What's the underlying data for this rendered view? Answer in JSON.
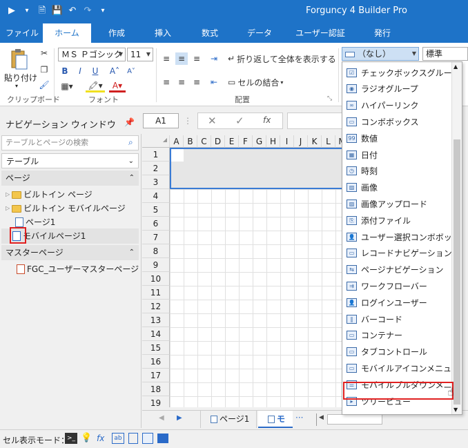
{
  "app": {
    "title": "Forguncy 4 Builder Pro"
  },
  "tabs": [
    "ファイル",
    "ホーム",
    "作成",
    "挿入",
    "数式",
    "データ",
    "ユーザー認証",
    "発行"
  ],
  "ribbon": {
    "paste_label": "貼り付け",
    "clipboard_label": "クリップボード",
    "font_name": "ＭＳ Ｐゴシック",
    "font_size": "11",
    "font_group_label": "フォント",
    "wrap_label": "折り返して全体を表示する",
    "merge_label": "セルの結合",
    "align_group_label": "配置",
    "celltype_selected": "（なし）",
    "style_value": "標準"
  },
  "formula_bar": {
    "cell_ref": "A1",
    "fx": "fx"
  },
  "nav": {
    "title": "ナビゲーション ウィンドウ",
    "search_placeholder": "テーブルとページの検索",
    "table_section": "テーブル",
    "page_section": "ページ",
    "pages": [
      "ビルトイン ページ",
      "ビルトイン モバイルページ",
      "ページ1",
      "モバイルページ1"
    ],
    "master_section": "マスターページ",
    "masters": [
      "FGC_ユーザーマスターページ"
    ]
  },
  "grid": {
    "columns": [
      "A",
      "B",
      "C",
      "D",
      "E",
      "F",
      "G",
      "H",
      "I",
      "J",
      "K",
      "L",
      "M"
    ],
    "rows": [
      "1",
      "2",
      "3",
      "4",
      "5",
      "6",
      "7",
      "8",
      "9",
      "10",
      "11",
      "12",
      "13",
      "14",
      "15",
      "16",
      "17",
      "18",
      "19"
    ]
  },
  "sheet_tabs": [
    "ページ1",
    "モ"
  ],
  "status": {
    "label": "セル表示モード："
  },
  "dropdown_items": [
    "チェックボックスグループ",
    "ラジオグループ",
    "ハイパーリンク",
    "コンボボックス",
    "数値",
    "日付",
    "時刻",
    "画像",
    "画像アップロード",
    "添付ファイル",
    "ユーザー選択コンボボックス",
    "レコードナビゲーション",
    "ページナビゲーション",
    "ワークフローバー",
    "ログインユーザー",
    "バーコード",
    "コンテナー",
    "タブコントロール",
    "モバイルアイコンメニュー",
    "モバイルプルダウンメニュー",
    "ツリービュー"
  ]
}
